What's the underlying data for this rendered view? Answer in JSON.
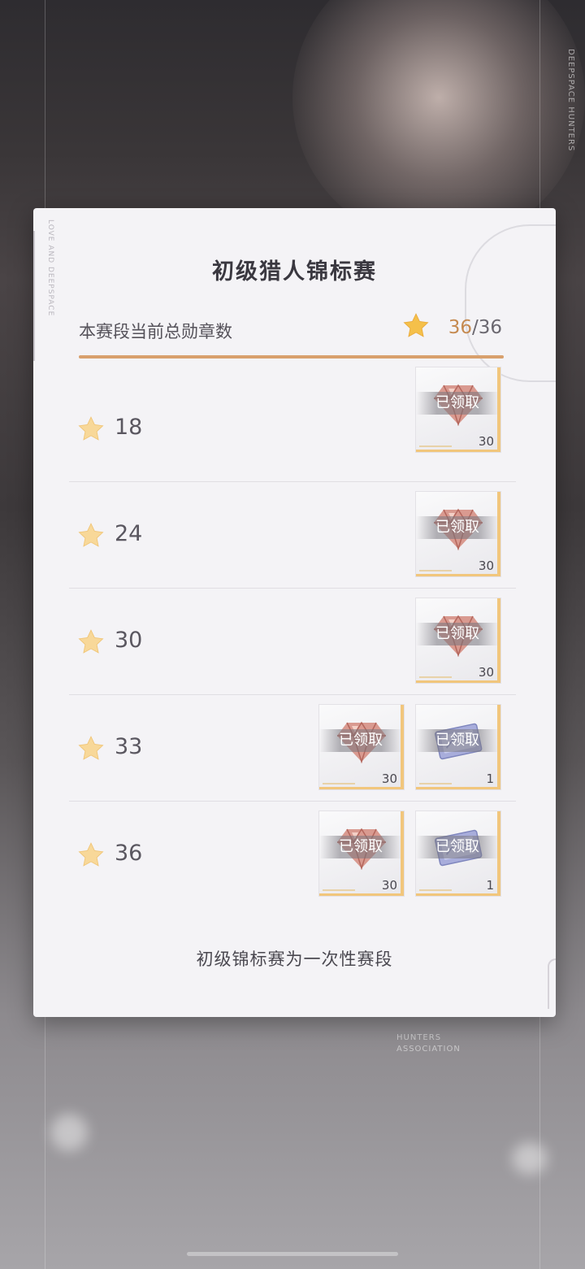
{
  "brand": {
    "vertical": "DEEPSPACE HUNTERS",
    "panel_side": "LOVE AND DEEPSPACE",
    "assoc_line1": "HUNTERS",
    "assoc_line2": "ASSOCIATION"
  },
  "panel": {
    "title": "初级猎人锦标赛",
    "total_label": "本赛段当前总勋章数",
    "total_current": "36",
    "total_separator": "/",
    "total_max": "36",
    "progress_fraction": 1.0,
    "footer": "初级锦标赛为一次性赛段"
  },
  "colors": {
    "accent": "#d8a06d",
    "star": "#f5c04a",
    "gold_edge": "#f1c67c",
    "gem_pink": "#c47a6e",
    "ticket_blue": "#8f96c9"
  },
  "tiers": [
    {
      "threshold": "18",
      "rewards": [
        {
          "icon": "gem-icon",
          "status": "已领取",
          "qty": "30"
        }
      ]
    },
    {
      "threshold": "24",
      "rewards": [
        {
          "icon": "gem-icon",
          "status": "已领取",
          "qty": "30"
        }
      ]
    },
    {
      "threshold": "30",
      "rewards": [
        {
          "icon": "gem-icon",
          "status": "已领取",
          "qty": "30"
        }
      ]
    },
    {
      "threshold": "33",
      "rewards": [
        {
          "icon": "gem-icon",
          "status": "已领取",
          "qty": "30"
        },
        {
          "icon": "ticket-icon",
          "status": "已领取",
          "qty": "1"
        }
      ]
    },
    {
      "threshold": "36",
      "rewards": [
        {
          "icon": "gem-icon",
          "status": "已领取",
          "qty": "30"
        },
        {
          "icon": "ticket-icon",
          "status": "已领取",
          "qty": "1"
        }
      ]
    }
  ]
}
